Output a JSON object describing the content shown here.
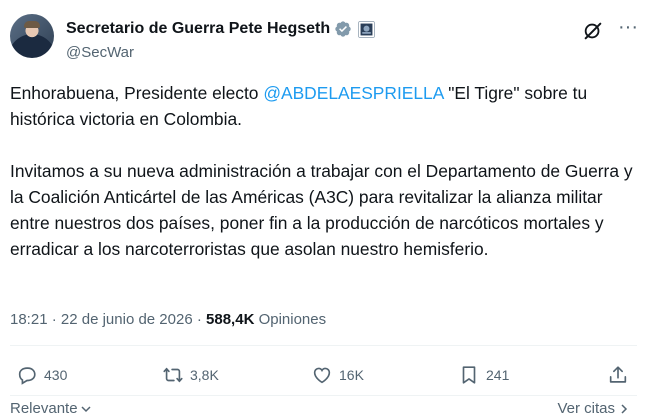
{
  "author": {
    "name": "Secretario de Guerra Pete Hegseth",
    "handle": "@SecWar",
    "icons": [
      "verified-badge-icon",
      "government-affiliation-icon"
    ]
  },
  "header_actions": {
    "grok_icon": "grok-icon",
    "more_icon": "more-horizontal-icon",
    "more_label": "···"
  },
  "tweet": {
    "p1_before": "Enhorabuena, Presidente electo ",
    "p1_mention": "@ABDELAESPRIELLA",
    "p1_after": " \"El Tigre\" sobre tu histórica victoria en Colombia.",
    "p2": "Invitamos a su nueva administración a trabajar con el Departamento de Guerra y la Coalición Anticártel de las Américas (A3C) para revitalizar la alianza militar entre nuestros dos países, poner fin a la producción de narcóticos mortales y erradicar a los narcoterroristas que asolan nuestro hemisferio."
  },
  "meta": {
    "time": "18:21",
    "separator": " · ",
    "date": "22 de junio de 2026",
    "separator2": " · ",
    "views": "588,4K",
    "views_label": " Opiniones"
  },
  "actions": {
    "replies": "430",
    "reposts": "3,8K",
    "likes": "16K",
    "bookmarks": "241"
  },
  "bottom": {
    "sort_label": "Relevante",
    "quotes_label": "Ver citas"
  },
  "colors": {
    "text": "#0f1419",
    "secondary": "#536471",
    "accent": "#1d9bf0",
    "divider": "#eff3f4"
  }
}
